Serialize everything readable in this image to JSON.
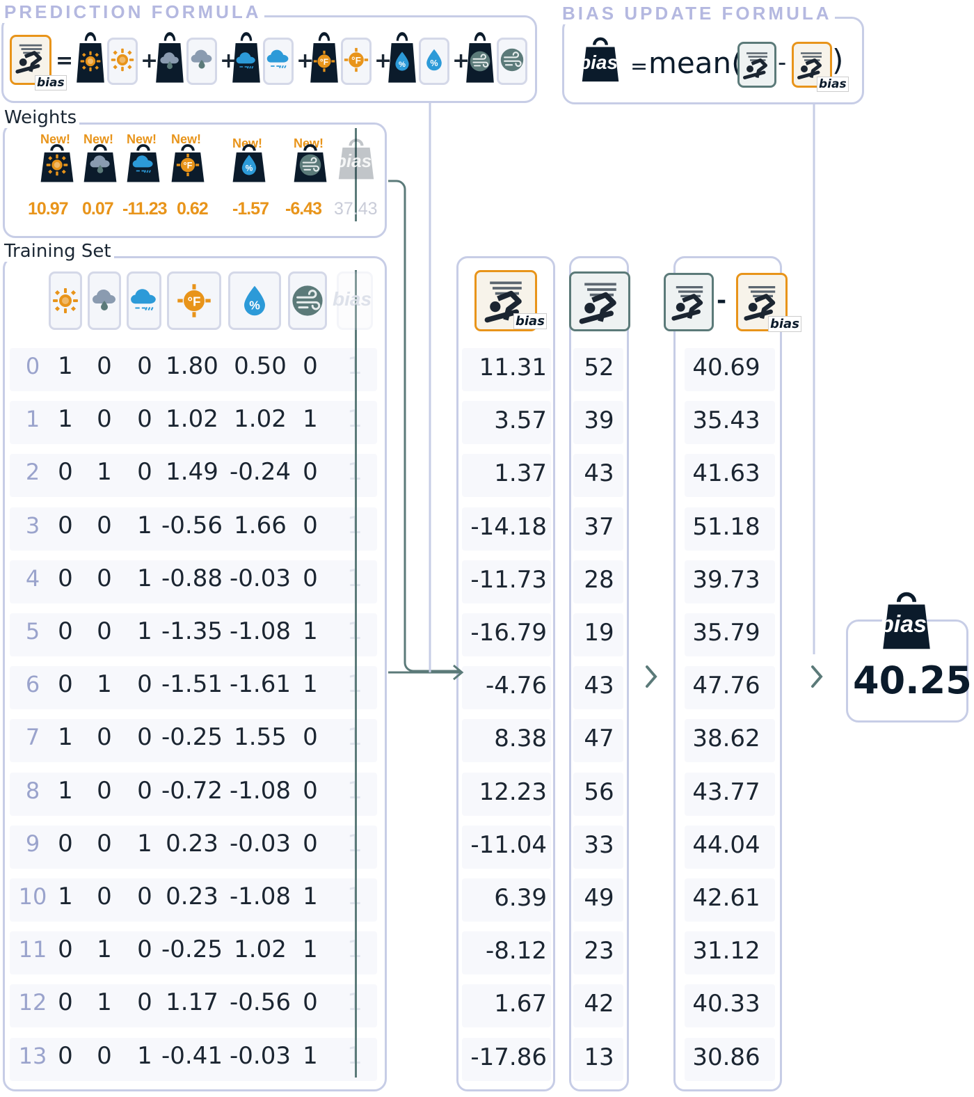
{
  "prediction_formula": {
    "title": "PREDICTION FORMULA",
    "equals": "=",
    "plus": "+",
    "bias_small": "bias"
  },
  "bias_update_formula": {
    "title": "BIAS UPDATE FORMULA",
    "bias_label": "bias",
    "equals": "=",
    "mean_open": "mean(",
    "minus": "-",
    "close": ")",
    "bias_small": "bias"
  },
  "weights": {
    "title": "Weights",
    "new_tag": "New!",
    "bias_label": "bias",
    "values": [
      "10.97",
      "0.07",
      "-11.23",
      "0.62",
      "-1.57",
      "-6.43"
    ],
    "bias_value": "37.43"
  },
  "training_set": {
    "title": "Training Set",
    "bias_label": "bias",
    "bias_column_value": "1",
    "rows": [
      {
        "idx": "0",
        "f": [
          "1",
          "0",
          "0",
          "1.80",
          "0.50",
          "0"
        ]
      },
      {
        "idx": "1",
        "f": [
          "1",
          "0",
          "0",
          "1.02",
          "1.02",
          "1"
        ]
      },
      {
        "idx": "2",
        "f": [
          "0",
          "1",
          "0",
          "1.49",
          "-0.24",
          "0"
        ]
      },
      {
        "idx": "3",
        "f": [
          "0",
          "0",
          "1",
          "-0.56",
          "1.66",
          "0"
        ]
      },
      {
        "idx": "4",
        "f": [
          "0",
          "0",
          "1",
          "-0.88",
          "-0.03",
          "0"
        ]
      },
      {
        "idx": "5",
        "f": [
          "0",
          "0",
          "1",
          "-1.35",
          "-1.08",
          "1"
        ]
      },
      {
        "idx": "6",
        "f": [
          "0",
          "1",
          "0",
          "-1.51",
          "-1.61",
          "1"
        ]
      },
      {
        "idx": "7",
        "f": [
          "1",
          "0",
          "0",
          "-0.25",
          "1.55",
          "0"
        ]
      },
      {
        "idx": "8",
        "f": [
          "1",
          "0",
          "0",
          "-0.72",
          "-1.08",
          "0"
        ]
      },
      {
        "idx": "9",
        "f": [
          "0",
          "0",
          "1",
          "0.23",
          "-0.03",
          "0"
        ]
      },
      {
        "idx": "10",
        "f": [
          "1",
          "0",
          "0",
          "0.23",
          "-1.08",
          "1"
        ]
      },
      {
        "idx": "11",
        "f": [
          "0",
          "1",
          "0",
          "-0.25",
          "1.02",
          "1"
        ]
      },
      {
        "idx": "12",
        "f": [
          "0",
          "1",
          "0",
          "1.17",
          "-0.56",
          "0"
        ]
      },
      {
        "idx": "13",
        "f": [
          "0",
          "0",
          "1",
          "-0.41",
          "-0.03",
          "1"
        ]
      }
    ]
  },
  "prediction_column": {
    "bias_small": "bias",
    "values": [
      "11.31",
      "3.57",
      "1.37",
      "-14.18",
      "-11.73",
      "-16.79",
      "-4.76",
      "8.38",
      "12.23",
      "-11.04",
      "6.39",
      "-8.12",
      "1.67",
      "-17.86"
    ]
  },
  "target_column": {
    "values": [
      "52",
      "39",
      "43",
      "37",
      "28",
      "19",
      "43",
      "47",
      "56",
      "33",
      "49",
      "23",
      "42",
      "13"
    ]
  },
  "difference_column": {
    "minus": "-",
    "bias_small": "bias",
    "values": [
      "40.69",
      "35.43",
      "41.63",
      "51.18",
      "39.73",
      "35.79",
      "47.76",
      "38.62",
      "43.77",
      "44.04",
      "42.61",
      "31.12",
      "40.33",
      "30.86"
    ]
  },
  "result": {
    "bias_label": "bias",
    "value": "40.25"
  },
  "colors": {
    "accent_orange": "#e8941a",
    "dark_navy": "#0b1b2b",
    "teal": "#5b7a79",
    "border": "#c7cde6",
    "sky_blue": "#2c9ad8"
  },
  "icons": [
    "sun-icon",
    "cloud-rain-icon",
    "cloud-snow-icon",
    "thermometer-fahrenheit-icon",
    "humidity-drop-icon",
    "wind-icon",
    "bias-weight-icon",
    "snowboarder-icon"
  ]
}
